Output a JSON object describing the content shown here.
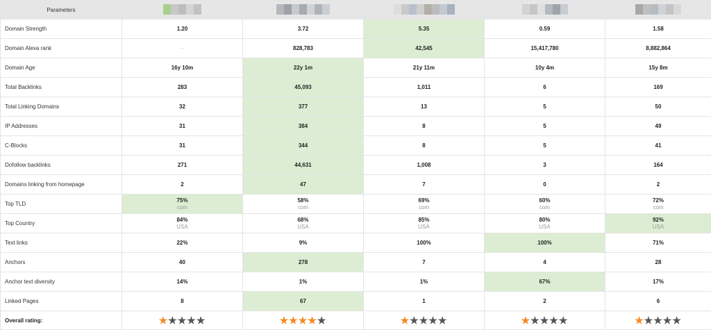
{
  "header": {
    "parameters_label": "Parameters",
    "sites": [
      {
        "blur_colors": [
          "#a9cf8d",
          "#c8c8c8",
          "#bdbdbd",
          "#d4d4d4",
          "#c2c2c2"
        ]
      },
      {
        "blur_colors": [
          "#b4b8bc",
          "#9ea2a6",
          "#c6c9cd",
          "#a7abaf",
          "#d0d3d6",
          "#b0b4b8",
          "#c9ced3"
        ]
      },
      {
        "blur_colors": [
          "#dddddd",
          "#c9c9c9",
          "#b9bfca",
          "#cfcfcf",
          "#b4aea8",
          "#bcbcbc",
          "#c3c9d3",
          "#a9b1bc"
        ]
      },
      {
        "blur_colors": [
          "#d3d3d3",
          "#c6c6c6",
          "#e0e0e0",
          "#b4b9c0",
          "#9fa5ad",
          "#c8ccd1"
        ]
      },
      {
        "blur_colors": [
          "#a8a8a8",
          "#bfbfbf",
          "#b7bcc3",
          "#cfd3d8",
          "#c4c4c4",
          "#d8d8d8"
        ]
      }
    ]
  },
  "rows": [
    {
      "label": "Domain Strength",
      "cells": [
        {
          "main": "1.20"
        },
        {
          "main": "3.72"
        },
        {
          "main": "5.35",
          "hl": true
        },
        {
          "main": "0.59"
        },
        {
          "main": "1.58"
        }
      ]
    },
    {
      "label": "Domain Alexa rank",
      "cells": [
        {
          "main": "-",
          "muted": true
        },
        {
          "main": "828,783"
        },
        {
          "main": "42,545",
          "hl": true
        },
        {
          "main": "15,417,780"
        },
        {
          "main": "8,882,864"
        }
      ]
    },
    {
      "label": "Domain Age",
      "cells": [
        {
          "main": "16y 10m"
        },
        {
          "main": "22y 1m",
          "hl": true
        },
        {
          "main": "21y 11m"
        },
        {
          "main": "10y 4m"
        },
        {
          "main": "15y 8m"
        }
      ]
    },
    {
      "label": "Total Backlinks",
      "cells": [
        {
          "main": "283"
        },
        {
          "main": "45,093",
          "hl": true
        },
        {
          "main": "1,011"
        },
        {
          "main": "6"
        },
        {
          "main": "169"
        }
      ]
    },
    {
      "label": "Total Linking Domains",
      "cells": [
        {
          "main": "32"
        },
        {
          "main": "377",
          "hl": true
        },
        {
          "main": "13"
        },
        {
          "main": "5"
        },
        {
          "main": "50"
        }
      ]
    },
    {
      "label": "IP Addresses",
      "cells": [
        {
          "main": "31"
        },
        {
          "main": "384",
          "hl": true
        },
        {
          "main": "8"
        },
        {
          "main": "5"
        },
        {
          "main": "49"
        }
      ]
    },
    {
      "label": "C-Blocks",
      "cells": [
        {
          "main": "31"
        },
        {
          "main": "344",
          "hl": true
        },
        {
          "main": "8"
        },
        {
          "main": "5"
        },
        {
          "main": "41"
        }
      ]
    },
    {
      "label": "Dofollow backlinks",
      "cells": [
        {
          "main": "271"
        },
        {
          "main": "44,631",
          "hl": true
        },
        {
          "main": "1,008"
        },
        {
          "main": "3"
        },
        {
          "main": "164"
        }
      ]
    },
    {
      "label": "Domains linking from homepage",
      "cells": [
        {
          "main": "2"
        },
        {
          "main": "47",
          "hl": true
        },
        {
          "main": "7"
        },
        {
          "main": "0"
        },
        {
          "main": "2"
        }
      ]
    },
    {
      "label": "Top TLD",
      "cells": [
        {
          "main": "75%",
          "sub": "com",
          "hl": true
        },
        {
          "main": "58%",
          "sub": "com"
        },
        {
          "main": "69%",
          "sub": "com"
        },
        {
          "main": "60%",
          "sub": "com"
        },
        {
          "main": "72%",
          "sub": "com"
        }
      ]
    },
    {
      "label": "Top Country",
      "cells": [
        {
          "main": "84%",
          "sub": "USA"
        },
        {
          "main": "68%",
          "sub": "USA"
        },
        {
          "main": "85%",
          "sub": "USA"
        },
        {
          "main": "80%",
          "sub": "USA"
        },
        {
          "main": "92%",
          "sub": "USA",
          "hl": true
        }
      ]
    },
    {
      "label": "Text links",
      "cells": [
        {
          "main": "22%"
        },
        {
          "main": "9%"
        },
        {
          "main": "100%"
        },
        {
          "main": "100%",
          "hl": true
        },
        {
          "main": "71%"
        }
      ]
    },
    {
      "label": "Anchors",
      "cells": [
        {
          "main": "40"
        },
        {
          "main": "278",
          "hl": true
        },
        {
          "main": "7"
        },
        {
          "main": "4"
        },
        {
          "main": "28"
        }
      ]
    },
    {
      "label": "Anchor text diversity",
      "cells": [
        {
          "main": "14%"
        },
        {
          "main": "1%"
        },
        {
          "main": "1%"
        },
        {
          "main": "67%",
          "hl": true
        },
        {
          "main": "17%"
        }
      ]
    },
    {
      "label": "Linked Pages",
      "cells": [
        {
          "main": "8"
        },
        {
          "main": "67",
          "hl": true
        },
        {
          "main": "1"
        },
        {
          "main": "2"
        },
        {
          "main": "6"
        }
      ]
    }
  ],
  "rating": {
    "label": "Overall rating:",
    "max_stars": 5,
    "star_glyph": "★",
    "on_color": "#f58a1f",
    "off_color": "#555555",
    "values": [
      1,
      4,
      1,
      1,
      1
    ]
  }
}
